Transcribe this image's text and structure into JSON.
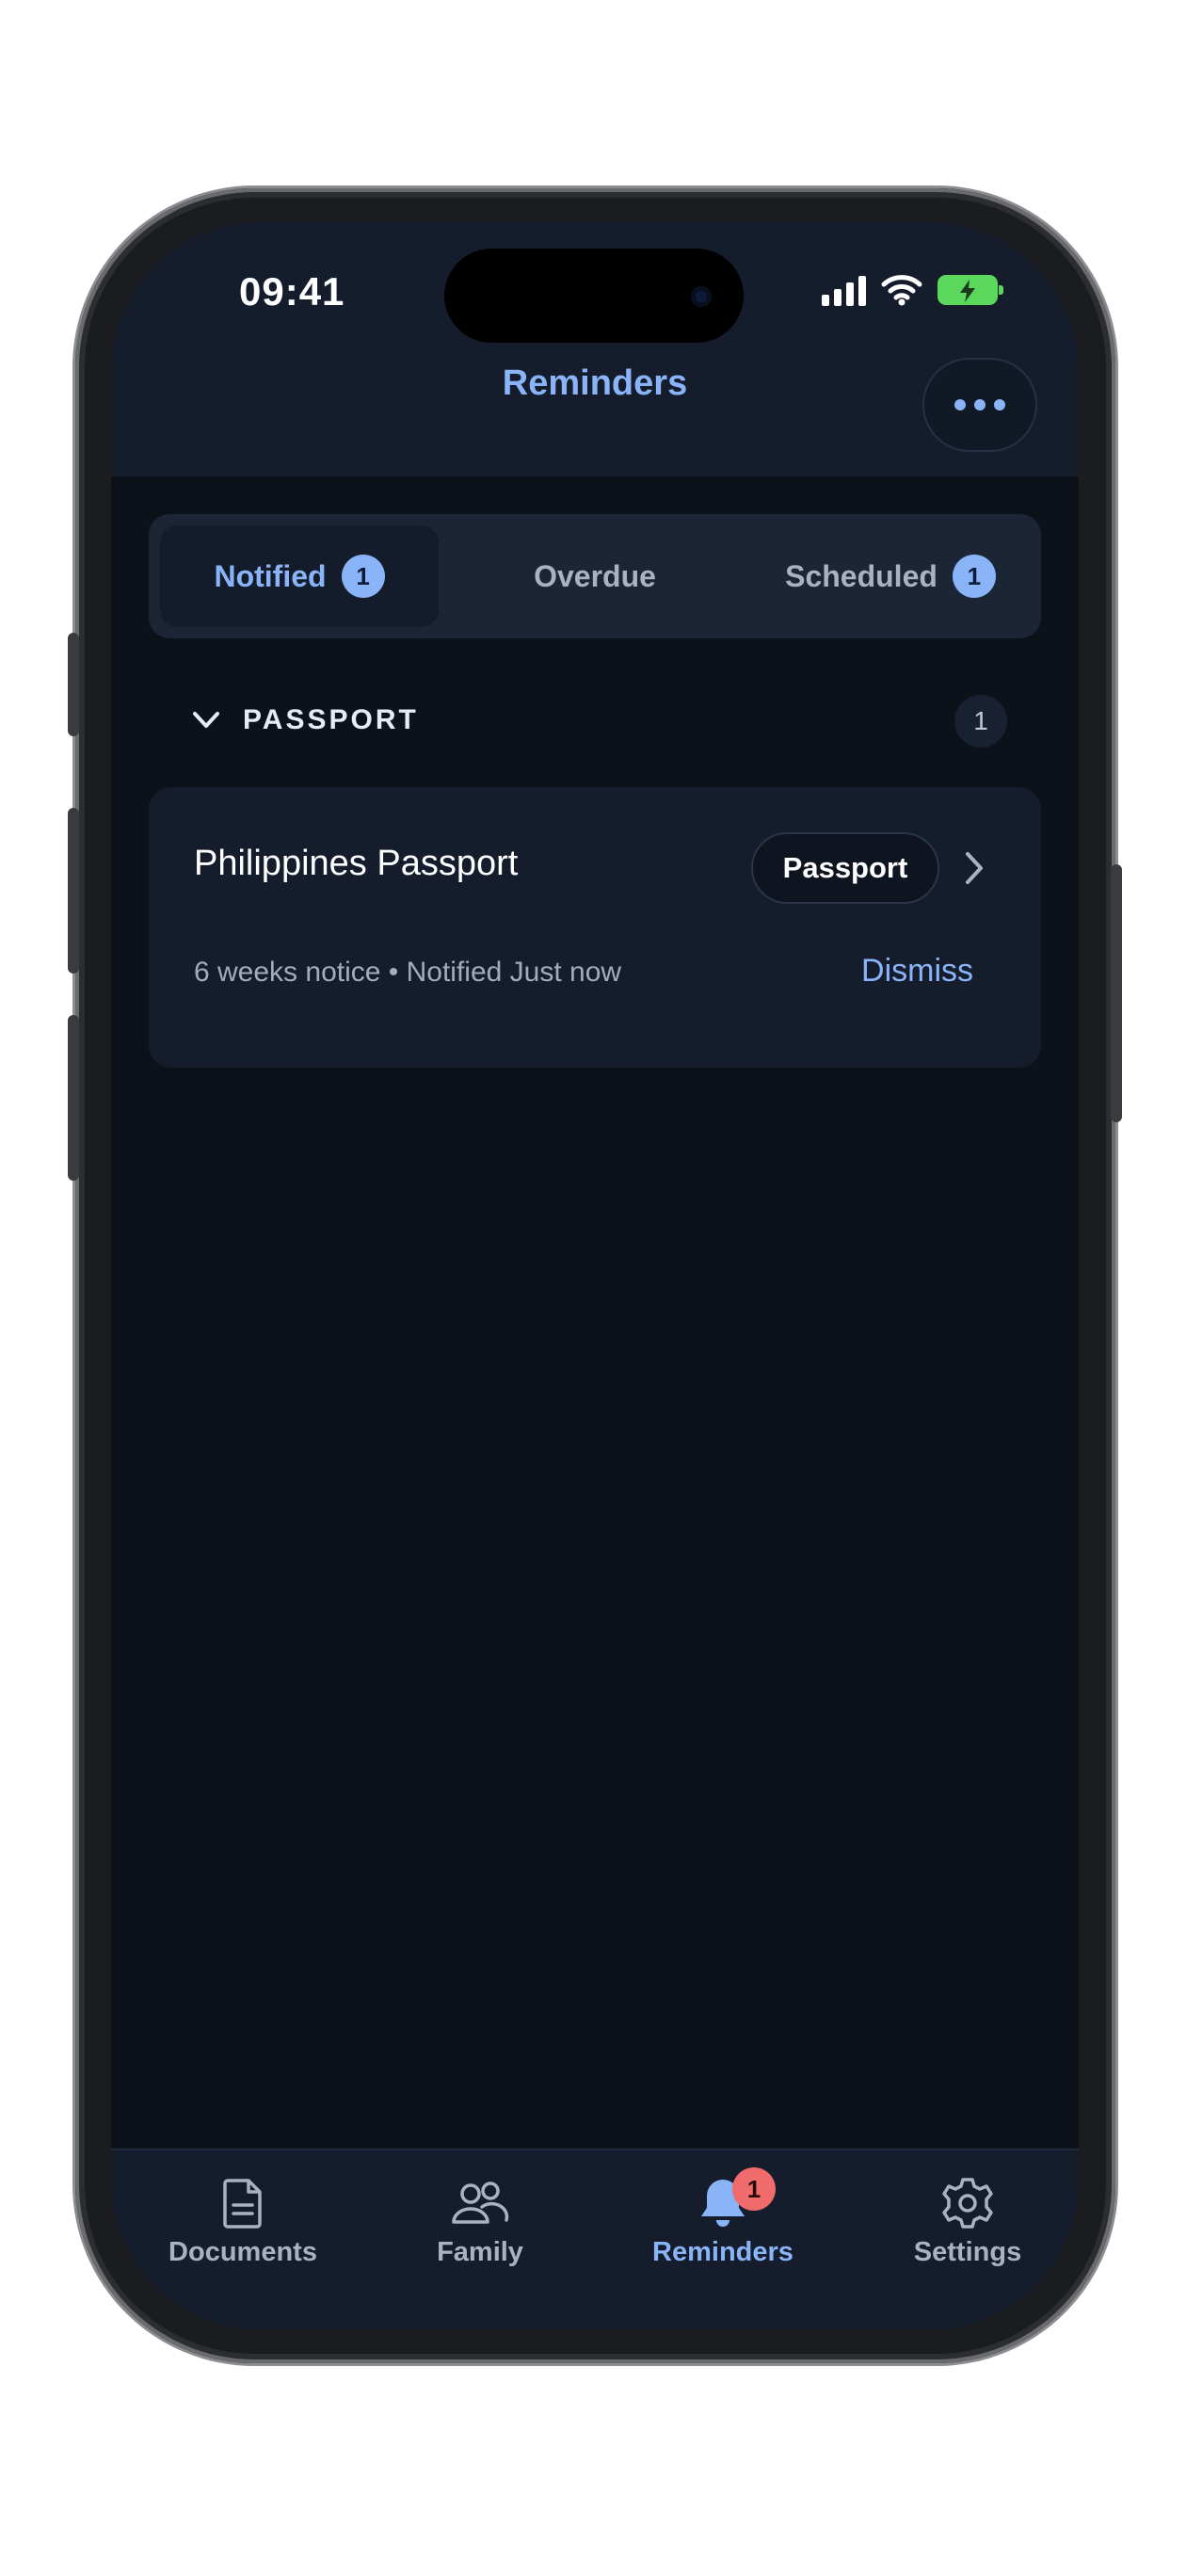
{
  "status_bar": {
    "time": "09:41"
  },
  "header": {
    "title": "Reminders"
  },
  "tabs": [
    {
      "label": "Notified",
      "count": "1",
      "active": true
    },
    {
      "label": "Overdue",
      "active": false
    },
    {
      "label": "Scheduled",
      "count": "1",
      "active": false
    }
  ],
  "group": {
    "title": "PASSPORT",
    "count": "1"
  },
  "reminder_card": {
    "title": "Philippines Passport",
    "category": "Passport",
    "meta": "6 weeks notice • Notified Just now",
    "dismiss_label": "Dismiss"
  },
  "bottom_nav": {
    "items": [
      {
        "label": "Documents",
        "icon": "document-icon"
      },
      {
        "label": "Family",
        "icon": "people-icon"
      },
      {
        "label": "Reminders",
        "icon": "bell-icon",
        "badge": "1",
        "active": true
      },
      {
        "label": "Settings",
        "icon": "gear-icon"
      }
    ]
  },
  "colors": {
    "accent": "#8ab4f8",
    "background": "#0d111a",
    "surface": "#151d2d",
    "badge_alert": "#f06b6b"
  }
}
